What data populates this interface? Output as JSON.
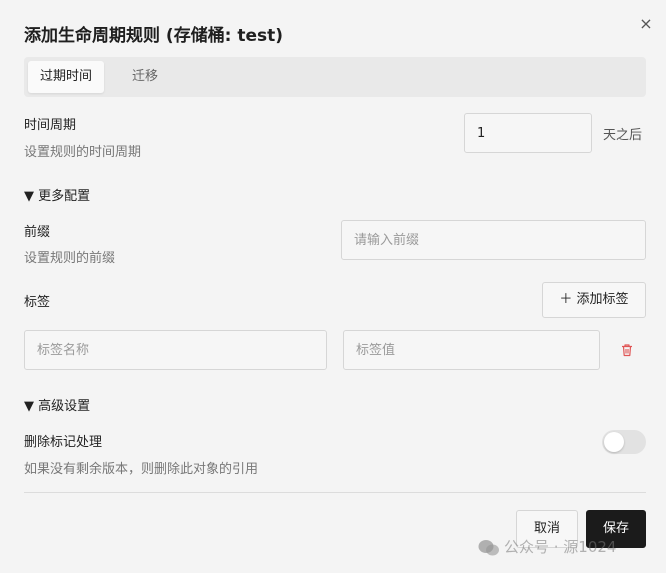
{
  "dialog": {
    "title": "添加生命周期规则 (存储桶: test)",
    "close_glyph": "×"
  },
  "tabs": [
    {
      "label": "过期时间",
      "active": true
    },
    {
      "label": "迁移",
      "active": false
    }
  ],
  "period": {
    "label": "时间周期",
    "hint": "设置规则的时间周期",
    "value": "1",
    "suffix": "天之后"
  },
  "more_config": {
    "label": "▼ 更多配置"
  },
  "prefix": {
    "label": "前缀",
    "hint": "设置规则的前缀",
    "placeholder": "请输入前缀"
  },
  "tags": {
    "label": "标签",
    "add_button": "＋ 添加标签",
    "name_placeholder": "标签名称",
    "value_placeholder": "标签值"
  },
  "advanced": {
    "label": "▼ 高级设置"
  },
  "delete_marker": {
    "label": "删除标记处理",
    "hint": "如果没有剩余版本，则删除此对象的引用",
    "enabled": false
  },
  "footer": {
    "cancel_label": "取消",
    "save_label": "保存"
  },
  "watermark": {
    "text": "公众号 · 源1024"
  },
  "colors": {
    "accent_dark": "#1b1b1b",
    "danger": "#e05555"
  }
}
